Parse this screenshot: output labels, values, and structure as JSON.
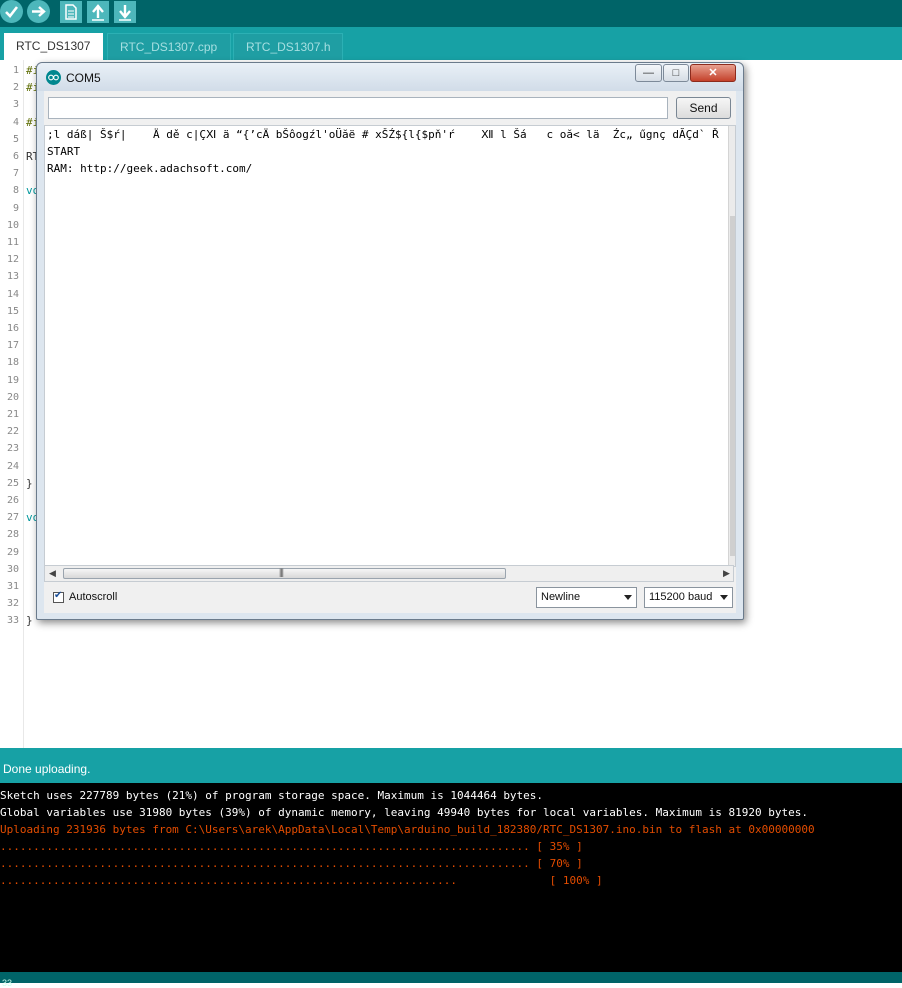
{
  "toolbar": {
    "buttons": [
      {
        "name": "verify",
        "icon": "check-icon"
      },
      {
        "name": "upload",
        "icon": "arrow-right-icon"
      },
      {
        "name": "new",
        "icon": "file-icon"
      },
      {
        "name": "open",
        "icon": "arrow-up-icon"
      },
      {
        "name": "save",
        "icon": "arrow-down-icon"
      }
    ]
  },
  "tabs": [
    {
      "label": "RTC_DS1307",
      "active": true
    },
    {
      "label": "RTC_DS1307.cpp",
      "active": false
    },
    {
      "label": "RTC_DS1307.h",
      "active": false
    }
  ],
  "editor": {
    "line_numbers": [
      "1",
      "2",
      "3",
      "4",
      "5",
      "6",
      "7",
      "8",
      "9",
      "10",
      "11",
      "12",
      "13",
      "14",
      "15",
      "16",
      "17",
      "18",
      "19",
      "20",
      "21",
      "22",
      "23",
      "24",
      "25",
      "26",
      "27",
      "28",
      "29",
      "30",
      "31",
      "32",
      "33"
    ],
    "visible_fragments": [
      {
        "line": 1,
        "text": "#i",
        "color": "#5e6d03"
      },
      {
        "line": 2,
        "text": "#i",
        "color": "#5e6d03"
      },
      {
        "line": 4,
        "text": "#i",
        "color": "#5e6d03"
      },
      {
        "line": 6,
        "text": "RT",
        "color": "#333333"
      },
      {
        "line": 8,
        "text": "vo",
        "color": "#00979c"
      },
      {
        "line": 25,
        "text": "}",
        "color": "#333333"
      },
      {
        "line": 27,
        "text": "vo",
        "color": "#00979c"
      },
      {
        "line": 33,
        "text": "}",
        "color": "#333333"
      }
    ]
  },
  "serial_monitor": {
    "title": "COM5",
    "window_buttons": [
      "minimize",
      "maximize",
      "close"
    ],
    "input_value": "",
    "send_label": "Send",
    "output_lines": [
      ";l dáß| Š$ŕ|    Ä dě c|ÇⅪ ä “{’cÄ bŠôogźl'oÜăë # xŠŹ${l{$pň'ŕ    Ⅻ l Šá   c oă< lä  Źc„ űgnç dĂÇd` Ř  'o",
      "START",
      "RAM: http://geek.adachsoft.com/"
    ],
    "autoscroll_label": "Autoscroll",
    "autoscroll_checked": true,
    "line_ending": "Newline",
    "baud_rate": "115200 baud"
  },
  "status": {
    "message": "Done uploading."
  },
  "console": {
    "lines": [
      {
        "text": "Sketch uses 227789 bytes (21%) of program storage space. Maximum is 1044464 bytes.",
        "color": "white"
      },
      {
        "text": "Global variables use 31980 bytes (39%) of dynamic memory, leaving 49940 bytes for local variables. Maximum is 81920 bytes.",
        "color": "white"
      },
      {
        "text": "Uploading 231936 bytes from C:\\Users\\arek\\AppData\\Local\\Temp\\arduino_build_182380/RTC_DS1307.ino.bin to flash at 0x00000000",
        "color": "orange"
      },
      {
        "text": "................................................................................ [ 35% ]",
        "color": "orange"
      },
      {
        "text": "................................................................................ [ 70% ]",
        "color": "orange"
      },
      {
        "text": ".....................................................................              [ 100% ]",
        "color": "orange"
      }
    ]
  },
  "bottom_bar": {
    "line_indicator": "33"
  }
}
